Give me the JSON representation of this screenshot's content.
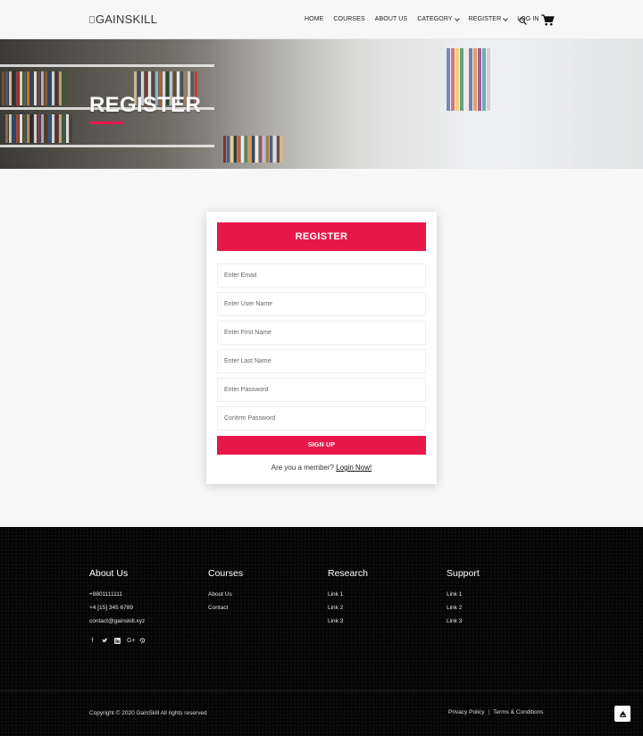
{
  "header": {
    "logo_text": "GAINSKILL",
    "nav": [
      "HOME",
      "COURSES",
      "ABOUT US",
      "CATEGORY",
      "REGISTER",
      "LOG IN"
    ],
    "icons": [
      "search-icon",
      "cart-icon"
    ]
  },
  "hero": {
    "title": "REGISTER",
    "accent": "#e8174a"
  },
  "form": {
    "title": "REGISTER",
    "fields": {
      "email": "Enter Email",
      "username": "Enter User Name",
      "first_name": "Enter First Name",
      "last_name": "Enter Last Name",
      "password": "Enter Password",
      "confirm": "Confirm Password"
    },
    "submit": "SIGN UP",
    "member_text": "Are you a member?",
    "login_link": "Login Now!"
  },
  "footer": {
    "about": {
      "title": "About Us",
      "phone1": "+8801111111",
      "phone2": "+4 [15] 345 6789",
      "email": "contact@gainskill.xyz"
    },
    "courses": {
      "title": "Courses",
      "links": [
        "About Us",
        "Contact"
      ]
    },
    "research": {
      "title": "Research",
      "links": [
        "Link 1",
        "Link 2",
        "Link 3"
      ]
    },
    "support": {
      "title": "Support",
      "links": [
        "Link 1",
        "Link 2",
        "Link 3"
      ]
    },
    "social": [
      "facebook-icon",
      "twitter-icon",
      "linkedin-icon",
      "google-plus-icon",
      "pinterest-icon"
    ],
    "copyright": "Copyright © 2020 GainSkill All rights reserved",
    "legal": [
      "Privacy Policy",
      "Terms & Conditions"
    ]
  },
  "colors": {
    "accent": "#e8174a",
    "footer_bg": "#050505"
  }
}
